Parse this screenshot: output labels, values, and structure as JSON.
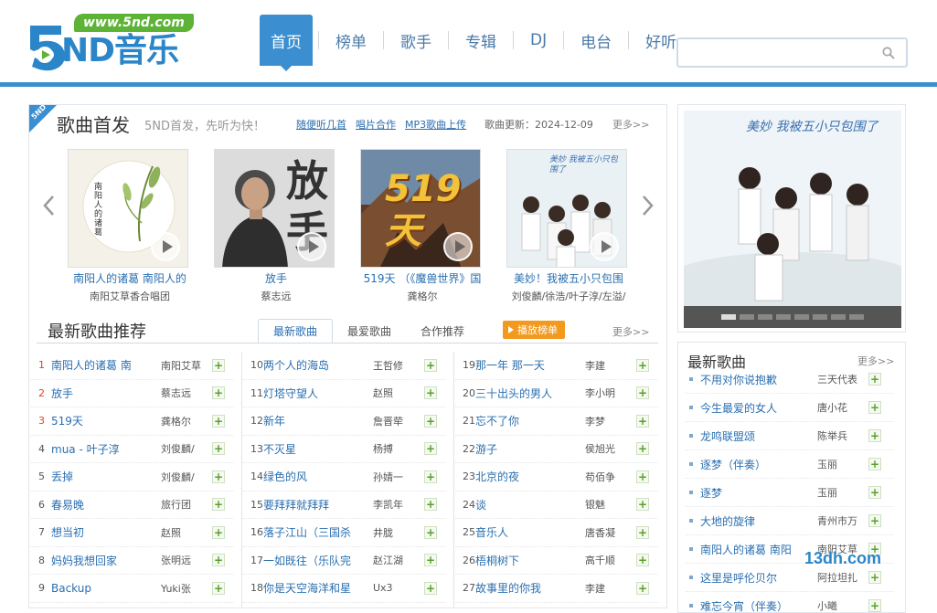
{
  "header": {
    "logo_url": "www.5nd.com",
    "logo_text": "ND音乐",
    "nav": [
      {
        "label": "首页",
        "active": true
      },
      {
        "label": "榜单"
      },
      {
        "label": "歌手"
      },
      {
        "label": "专辑"
      },
      {
        "label": "DJ"
      },
      {
        "label": "电台"
      },
      {
        "label": "好听"
      }
    ],
    "search": {
      "value": "",
      "placeholder": ""
    }
  },
  "premiere": {
    "corner_tag": "5ND",
    "title": "歌曲首发",
    "subtitle": "5ND首发，先听为快！",
    "links": [
      "随便听几首",
      "唱片合作",
      "MP3歌曲上传"
    ],
    "update_text": "歌曲更新：2024-12-09",
    "more": "更多>>",
    "albums": [
      {
        "title": "南阳人的诸葛 南阳人的",
        "artist": "南阳艾草香合唱团",
        "cover_text": "南阳人的诸葛"
      },
      {
        "title": "放手",
        "artist": "蔡志远",
        "cover_text": "放手"
      },
      {
        "title": "519天 （《魔兽世界》国",
        "artist": "龚格尔",
        "cover_text": "519天"
      },
      {
        "title": "美妙！我被五小只包围",
        "artist": "刘俊麟/徐浩/叶子淳/左溢/",
        "cover_text": "美妙 我被五小只包围了"
      }
    ]
  },
  "recommend": {
    "title": "最新歌曲推荐",
    "tabs": [
      "最新歌曲",
      "最爱歌曲",
      "合作推荐"
    ],
    "active_tab": 0,
    "play_label": "播放榜单",
    "more": "更多>>",
    "columns": [
      [
        {
          "num": "1",
          "song": "南阳人的诸葛 南",
          "artist": "南阳艾草"
        },
        {
          "num": "2",
          "song": "放手",
          "artist": "蔡志远"
        },
        {
          "num": "3",
          "song": "519天",
          "artist": "龚格尔"
        },
        {
          "num": "4",
          "song": "mua - 叶子淳",
          "artist": "刘俊麟/"
        },
        {
          "num": "5",
          "song": "丢掉",
          "artist": "刘俊麟/"
        },
        {
          "num": "6",
          "song": "春易晚",
          "artist": "旅行团"
        },
        {
          "num": "7",
          "song": "想当初",
          "artist": "赵照"
        },
        {
          "num": "8",
          "song": "妈妈我想回家",
          "artist": "张明远"
        },
        {
          "num": "9",
          "song": "Backup",
          "artist": "Yuki张"
        }
      ],
      [
        {
          "num": "10",
          "song": "两个人的海岛",
          "artist": "王哲修"
        },
        {
          "num": "11",
          "song": "灯塔守望人",
          "artist": "赵照"
        },
        {
          "num": "12",
          "song": "新年",
          "artist": "詹晋荦"
        },
        {
          "num": "13",
          "song": "不灭星",
          "artist": "杨搏"
        },
        {
          "num": "14",
          "song": "绿色的风",
          "artist": "孙婧一"
        },
        {
          "num": "15",
          "song": "要拜拜就拜拜",
          "artist": "李凯年"
        },
        {
          "num": "16",
          "song": "落子江山（三国杀",
          "artist": "井胧"
        },
        {
          "num": "17",
          "song": "一如既往（乐队完",
          "artist": "赵江湖"
        },
        {
          "num": "18",
          "song": "你是天空海洋和星",
          "artist": "Ux3"
        }
      ],
      [
        {
          "num": "19",
          "song": "那一年 那一天",
          "artist": "李建"
        },
        {
          "num": "20",
          "song": "三十出头的男人",
          "artist": "李小明"
        },
        {
          "num": "21",
          "song": "忘不了你",
          "artist": "李梦"
        },
        {
          "num": "22",
          "song": "游子",
          "artist": "侯旭光"
        },
        {
          "num": "23",
          "song": "北京的夜",
          "artist": "苟佰争"
        },
        {
          "num": "24",
          "song": "谈",
          "artist": "银魅"
        },
        {
          "num": "25",
          "song": "音乐人",
          "artist": "唐香凝"
        },
        {
          "num": "26",
          "song": "梧桐树下",
          "artist": "高千顺"
        },
        {
          "num": "27",
          "song": "故事里的你我",
          "artist": "李建"
        }
      ]
    ]
  },
  "banner": {
    "caption": "美妙 我被五小只包围了",
    "dots": 8,
    "active_dot": 0
  },
  "newsongs": {
    "title": "最新歌曲",
    "more": "更多>>",
    "items": [
      {
        "song": "不用对你说抱歉",
        "artist": "三天代表"
      },
      {
        "song": "今生最爱的女人",
        "artist": "唐小花"
      },
      {
        "song": "龙鸣联盟颂",
        "artist": "陈举兵"
      },
      {
        "song": "逐梦（伴奏）",
        "artist": "玉丽"
      },
      {
        "song": "逐梦",
        "artist": "玉丽"
      },
      {
        "song": "大地的旋律",
        "artist": "青州市万"
      },
      {
        "song": "南阳人的诸葛 南阳",
        "artist": "南阳艾草"
      },
      {
        "song": "这里是呼伦贝尔",
        "artist": "阿拉坦扎"
      },
      {
        "song": "难忘今宵（伴奏）",
        "artist": "小曦"
      }
    ]
  },
  "watermark": "13dh.com",
  "add_symbol": "+",
  "colors": {
    "brand_blue": "#3b8fd0",
    "link": "#2a6fb0",
    "logo_green": "#5cb335",
    "play_orange": "#f39a1e",
    "hot_red": "#e2421f"
  }
}
